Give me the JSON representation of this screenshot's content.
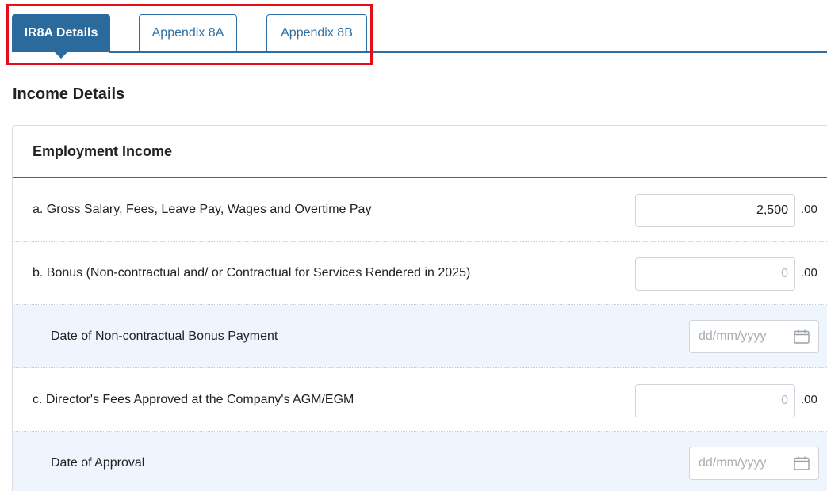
{
  "tabs": [
    {
      "label": "IR8A Details",
      "active": true
    },
    {
      "label": "Appendix 8A",
      "active": false
    },
    {
      "label": "Appendix 8B",
      "active": false
    }
  ],
  "section_title": "Income Details",
  "card": {
    "title": "Employment Income",
    "rows": [
      {
        "label": "a. Gross Salary, Fees, Leave Pay, Wages and Overtime Pay",
        "value": "2,500",
        "cents": ".00"
      },
      {
        "label": "b. Bonus (Non-contractual and/ or Contractual for Services Rendered in 2025)",
        "placeholder": "0",
        "cents": ".00"
      },
      {
        "label": "Date of Non-contractual Bonus Payment",
        "date_placeholder": "dd/mm/yyyy"
      },
      {
        "label": "c. Director's Fees Approved at the Company's AGM/EGM",
        "placeholder": "0",
        "cents": ".00"
      },
      {
        "label": "Date of Approval",
        "date_placeholder": "dd/mm/yyyy"
      }
    ]
  },
  "colors": {
    "primary": "#2b6a9c",
    "highlight": "#e3101a",
    "sub_row_bg": "#eef5fc"
  },
  "icons": {
    "calendar": "calendar-icon"
  }
}
